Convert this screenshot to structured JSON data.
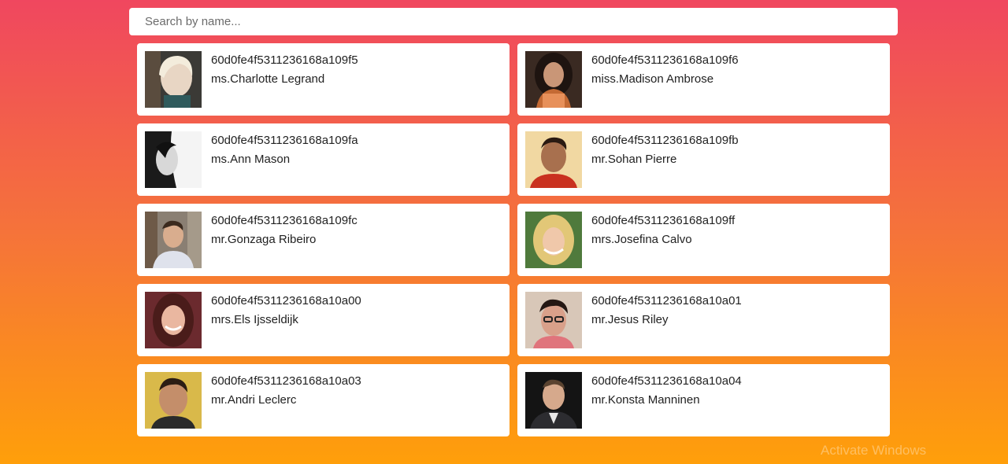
{
  "search": {
    "placeholder": "Search by name..."
  },
  "users": [
    {
      "id": "60d0fe4f5311236168a109f5",
      "name": "ms.Charlotte Legrand",
      "photo": "woman-blonde"
    },
    {
      "id": "60d0fe4f5311236168a109f6",
      "name": "miss.Madison Ambrose",
      "photo": "woman-dark-hair"
    },
    {
      "id": "60d0fe4f5311236168a109fa",
      "name": "ms.Ann Mason",
      "photo": "woman-bw"
    },
    {
      "id": "60d0fe4f5311236168a109fb",
      "name": "mr.Sohan Pierre",
      "photo": "man-red-shirt"
    },
    {
      "id": "60d0fe4f5311236168a109fc",
      "name": "mr.Gonzaga Ribeiro",
      "photo": "man-street"
    },
    {
      "id": "60d0fe4f5311236168a109ff",
      "name": "mrs.Josefina Calvo",
      "photo": "woman-blonde-smile"
    },
    {
      "id": "60d0fe4f5311236168a10a00",
      "name": "mrs.Els Ijsseldijk",
      "photo": "woman-brunette"
    },
    {
      "id": "60d0fe4f5311236168a10a01",
      "name": "mr.Jesus Riley",
      "photo": "man-glasses"
    },
    {
      "id": "60d0fe4f5311236168a10a03",
      "name": "mr.Andri Leclerc",
      "photo": "man-yellow-bg"
    },
    {
      "id": "60d0fe4f5311236168a10a04",
      "name": "mr.Konsta Manninen",
      "photo": "man-dark-bg"
    }
  ],
  "watermark": "Activate Windows"
}
